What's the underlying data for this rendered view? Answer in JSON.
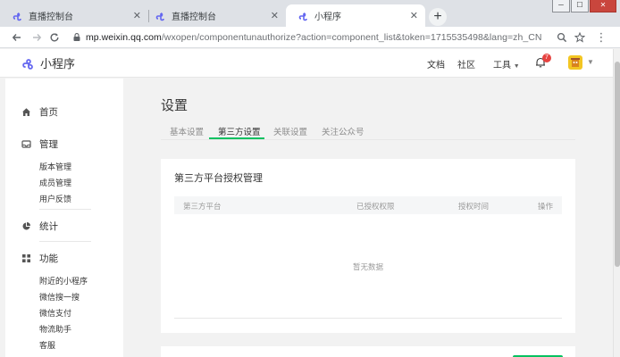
{
  "browser": {
    "tabs": [
      {
        "title": "直播控制台",
        "favicon": "miniprogram-icon"
      },
      {
        "title": "直播控制台",
        "favicon": "miniprogram-icon"
      },
      {
        "title": "小程序",
        "favicon": "miniprogram-icon",
        "active": true
      }
    ],
    "new_tab": "+",
    "window_controls": {
      "minimize": "─",
      "maximize": "☐",
      "close": "✕"
    },
    "url_host": "mp.weixin.qq.com",
    "url_path": "/wxopen/componentunauthorize?action=component_list&token=1715535498&lang=zh_CN"
  },
  "header": {
    "logo_text": "小程序",
    "links": {
      "docs": "文档",
      "community": "社区",
      "tools": "工具"
    },
    "notification_count": "7",
    "colors": {
      "brand": "#07c160",
      "badge": "#e64340"
    }
  },
  "sidebar": {
    "home": "首页",
    "manage": {
      "label": "管理",
      "items": [
        "版本管理",
        "成员管理",
        "用户反馈"
      ]
    },
    "stats": "统计",
    "features": {
      "label": "功能",
      "items": [
        "附近的小程序",
        "微信搜一搜",
        "微信支付",
        "物流助手",
        "客服"
      ]
    }
  },
  "main": {
    "title": "设置",
    "tabs": [
      "基本设置",
      "第三方设置",
      "关联设置",
      "关注公众号"
    ],
    "active_tab": "第三方设置",
    "card": {
      "title": "第三方平台授权管理",
      "columns": [
        "第三方平台",
        "已授权权限",
        "授权时间",
        "操作"
      ],
      "empty_text": "暂无数据"
    }
  }
}
